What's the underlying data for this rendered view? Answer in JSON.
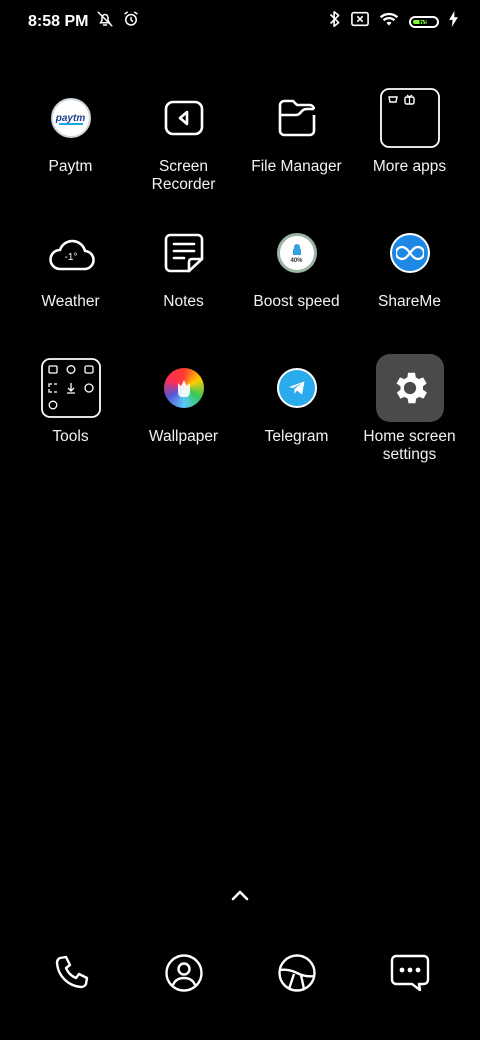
{
  "status_bar": {
    "time": "8:58 PM",
    "battery_level": "69",
    "battery_fraction": 0.69,
    "icons": [
      "notifications-off-icon",
      "alarm-icon",
      "bluetooth-icon",
      "sim-disabled-icon",
      "wifi-icon",
      "battery-icon",
      "charging-icon"
    ]
  },
  "apps": [
    {
      "label": "Paytm",
      "icon": "paytm-icon"
    },
    {
      "label": "Screen Recorder",
      "icon": "screen-recorder-icon"
    },
    {
      "label": "File Manager",
      "icon": "file-manager-icon"
    },
    {
      "label": "More apps",
      "icon": "more-apps-folder-icon"
    },
    {
      "label": "Weather",
      "icon": "weather-cloud-icon",
      "badge": "-1°"
    },
    {
      "label": "Notes",
      "icon": "notes-icon"
    },
    {
      "label": "Boost speed",
      "icon": "boost-speed-icon",
      "badge": "40%"
    },
    {
      "label": "ShareMe",
      "icon": "shareme-icon"
    },
    {
      "label": "Tools",
      "icon": "tools-folder-icon"
    },
    {
      "label": "Wallpaper",
      "icon": "wallpaper-icon"
    },
    {
      "label": "Telegram",
      "icon": "telegram-icon"
    },
    {
      "label": "Home screen settings",
      "icon": "gear-icon"
    }
  ],
  "dock": [
    {
      "icon": "phone-icon"
    },
    {
      "icon": "contacts-icon"
    },
    {
      "icon": "browser-icon"
    },
    {
      "icon": "messages-icon"
    }
  ],
  "colors": {
    "background": "#000000",
    "battery_fill": "#7CFF33",
    "telegram": "#2AABEE",
    "settings_tile": "#4A4A4A"
  }
}
